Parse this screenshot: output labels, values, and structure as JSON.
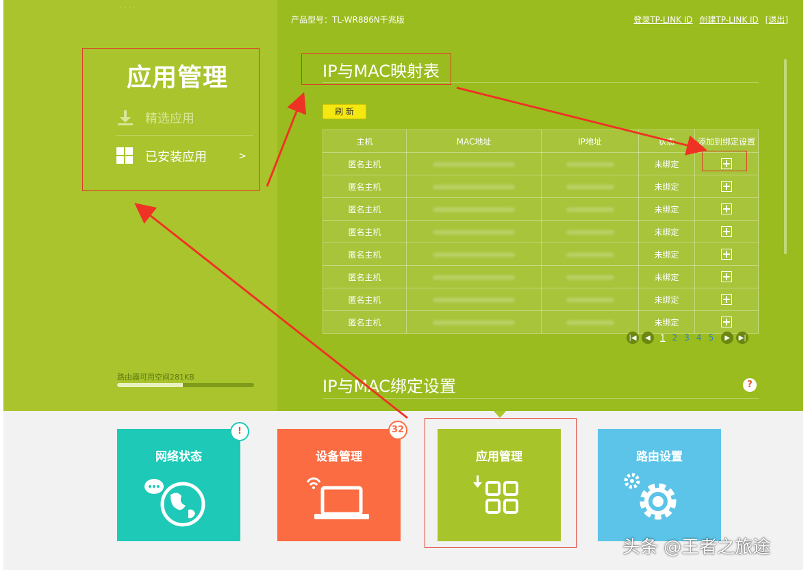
{
  "header": {
    "model_label": "产品型号：TL-WR886N千兆版",
    "login_link": "登录TP-LINK ID",
    "create_link": "创建TP-LINK ID",
    "logout_link": "[退出]"
  },
  "sidebar": {
    "title": "应用管理",
    "items": [
      {
        "label": "精选应用",
        "icon": "download-icon"
      },
      {
        "label": "已安装应用",
        "icon": "grid-icon",
        "arrow": ">"
      }
    ],
    "storage_text": "路由器可用空间281KB",
    "storage_fraction": 0.48
  },
  "main": {
    "mapping_title": "IP与MAC映射表",
    "refresh_label": "刷 新",
    "table": {
      "headers": [
        "主机",
        "MAC地址",
        "IP地址",
        "状态",
        "添加到绑定设置"
      ],
      "rows": [
        {
          "host": "匿名主机",
          "status": "未绑定"
        },
        {
          "host": "匿名主机",
          "status": "未绑定"
        },
        {
          "host": "匿名主机",
          "status": "未绑定"
        },
        {
          "host": "匿名主机",
          "status": "未绑定"
        },
        {
          "host": "匿名主机",
          "status": "未绑定"
        },
        {
          "host": "匿名主机",
          "status": "未绑定"
        },
        {
          "host": "匿名主机",
          "status": "未绑定"
        },
        {
          "host": "匿名主机",
          "status": "未绑定"
        }
      ]
    },
    "pagination": {
      "pages": [
        "1",
        "2",
        "3",
        "4",
        "5"
      ],
      "current": "1"
    },
    "binding_title": "IP与MAC绑定设置",
    "help_label": "?"
  },
  "tiles": [
    {
      "label": "网络状态",
      "color": "#1ec9b7"
    },
    {
      "label": "设备管理",
      "color": "#fb6c42"
    },
    {
      "label": "应用管理",
      "color": "#a8c42b"
    },
    {
      "label": "路由设置",
      "color": "#5bc4e8"
    }
  ],
  "badges": {
    "network_warning": "!",
    "device_count": "32"
  },
  "watermark": "头条 @王者之旅途"
}
